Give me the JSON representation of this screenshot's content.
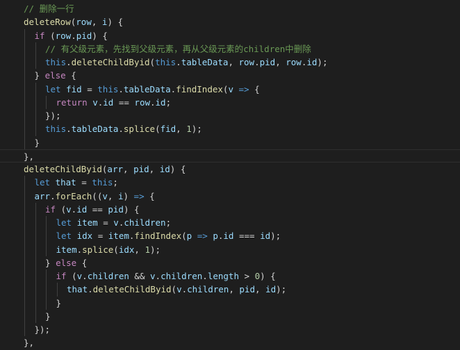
{
  "editor": {
    "theme_colors": {
      "background": "#1e1e1e",
      "comment": "#6a9955",
      "function": "#dcdcaa",
      "keyword": "#569cd6",
      "control": "#c586c0",
      "variable": "#9cdcfe",
      "number": "#b5cea8",
      "punctuation": "#d4d4d4"
    },
    "current_line": 11,
    "lines": [
      {
        "indent": 0,
        "tokens": [
          [
            "comment",
            "// 删除一行"
          ]
        ]
      },
      {
        "indent": 0,
        "tokens": [
          [
            "fn",
            "deleteRow"
          ],
          [
            "punc",
            "("
          ],
          [
            "var",
            "row"
          ],
          [
            "punc",
            ", "
          ],
          [
            "var",
            "i"
          ],
          [
            "punc",
            ") {"
          ]
        ]
      },
      {
        "indent": 1,
        "tokens": [
          [
            "ctrl",
            "if"
          ],
          [
            "punc",
            " ("
          ],
          [
            "var",
            "row"
          ],
          [
            "punc",
            "."
          ],
          [
            "var",
            "pid"
          ],
          [
            "punc",
            ") {"
          ]
        ]
      },
      {
        "indent": 2,
        "tokens": [
          [
            "comment",
            "// 有父级元素，先找到父级元素，再从父级元素的children中删除"
          ]
        ]
      },
      {
        "indent": 2,
        "tokens": [
          [
            "kw",
            "this"
          ],
          [
            "punc",
            "."
          ],
          [
            "fn",
            "deleteChildByid"
          ],
          [
            "punc",
            "("
          ],
          [
            "kw",
            "this"
          ],
          [
            "punc",
            "."
          ],
          [
            "var",
            "tableData"
          ],
          [
            "punc",
            ", "
          ],
          [
            "var",
            "row"
          ],
          [
            "punc",
            "."
          ],
          [
            "var",
            "pid"
          ],
          [
            "punc",
            ", "
          ],
          [
            "var",
            "row"
          ],
          [
            "punc",
            "."
          ],
          [
            "var",
            "id"
          ],
          [
            "punc",
            ");"
          ]
        ]
      },
      {
        "indent": 1,
        "tokens": [
          [
            "punc",
            "} "
          ],
          [
            "ctrl",
            "else"
          ],
          [
            "punc",
            " {"
          ]
        ]
      },
      {
        "indent": 2,
        "tokens": [
          [
            "kw",
            "let"
          ],
          [
            "punc",
            " "
          ],
          [
            "var",
            "fid"
          ],
          [
            "op",
            " = "
          ],
          [
            "kw",
            "this"
          ],
          [
            "punc",
            "."
          ],
          [
            "var",
            "tableData"
          ],
          [
            "punc",
            "."
          ],
          [
            "fn",
            "findIndex"
          ],
          [
            "punc",
            "("
          ],
          [
            "var",
            "v"
          ],
          [
            "kw",
            " => "
          ],
          [
            "punc",
            "{"
          ]
        ]
      },
      {
        "indent": 3,
        "tokens": [
          [
            "ctrl",
            "return"
          ],
          [
            "punc",
            " "
          ],
          [
            "var",
            "v"
          ],
          [
            "punc",
            "."
          ],
          [
            "var",
            "id"
          ],
          [
            "op",
            " == "
          ],
          [
            "var",
            "row"
          ],
          [
            "punc",
            "."
          ],
          [
            "var",
            "id"
          ],
          [
            "punc",
            ";"
          ]
        ]
      },
      {
        "indent": 2,
        "tokens": [
          [
            "punc",
            "});"
          ]
        ]
      },
      {
        "indent": 2,
        "tokens": [
          [
            "kw",
            "this"
          ],
          [
            "punc",
            "."
          ],
          [
            "var",
            "tableData"
          ],
          [
            "punc",
            "."
          ],
          [
            "fn",
            "splice"
          ],
          [
            "punc",
            "("
          ],
          [
            "var",
            "fid"
          ],
          [
            "punc",
            ", "
          ],
          [
            "num",
            "1"
          ],
          [
            "punc",
            ");"
          ]
        ]
      },
      {
        "indent": 1,
        "tokens": [
          [
            "punc",
            "}"
          ]
        ]
      },
      {
        "indent": 0,
        "tokens": [
          [
            "punc",
            "},"
          ]
        ]
      },
      {
        "indent": 0,
        "tokens": [
          [
            "fn",
            "deleteChildByid"
          ],
          [
            "punc",
            "("
          ],
          [
            "var",
            "arr"
          ],
          [
            "punc",
            ", "
          ],
          [
            "var",
            "pid"
          ],
          [
            "punc",
            ", "
          ],
          [
            "var",
            "id"
          ],
          [
            "punc",
            ") {"
          ]
        ]
      },
      {
        "indent": 1,
        "tokens": [
          [
            "kw",
            "let"
          ],
          [
            "punc",
            " "
          ],
          [
            "var",
            "that"
          ],
          [
            "op",
            " = "
          ],
          [
            "kw",
            "this"
          ],
          [
            "punc",
            ";"
          ]
        ]
      },
      {
        "indent": 1,
        "tokens": [
          [
            "var",
            "arr"
          ],
          [
            "punc",
            "."
          ],
          [
            "fn",
            "forEach"
          ],
          [
            "punc",
            "(("
          ],
          [
            "var",
            "v"
          ],
          [
            "punc",
            ", "
          ],
          [
            "var",
            "i"
          ],
          [
            "punc",
            ")"
          ],
          [
            "kw",
            " => "
          ],
          [
            "punc",
            "{"
          ]
        ]
      },
      {
        "indent": 2,
        "tokens": [
          [
            "ctrl",
            "if"
          ],
          [
            "punc",
            " ("
          ],
          [
            "var",
            "v"
          ],
          [
            "punc",
            "."
          ],
          [
            "var",
            "id"
          ],
          [
            "op",
            " == "
          ],
          [
            "var",
            "pid"
          ],
          [
            "punc",
            ") {"
          ]
        ]
      },
      {
        "indent": 3,
        "tokens": [
          [
            "kw",
            "let"
          ],
          [
            "punc",
            " "
          ],
          [
            "var",
            "item"
          ],
          [
            "op",
            " = "
          ],
          [
            "var",
            "v"
          ],
          [
            "punc",
            "."
          ],
          [
            "var",
            "children"
          ],
          [
            "punc",
            ";"
          ]
        ]
      },
      {
        "indent": 3,
        "tokens": [
          [
            "kw",
            "let"
          ],
          [
            "punc",
            " "
          ],
          [
            "var",
            "idx"
          ],
          [
            "op",
            " = "
          ],
          [
            "var",
            "item"
          ],
          [
            "punc",
            "."
          ],
          [
            "fn",
            "findIndex"
          ],
          [
            "punc",
            "("
          ],
          [
            "var",
            "p"
          ],
          [
            "kw",
            " => "
          ],
          [
            "var",
            "p"
          ],
          [
            "punc",
            "."
          ],
          [
            "var",
            "id"
          ],
          [
            "op",
            " === "
          ],
          [
            "var",
            "id"
          ],
          [
            "punc",
            ");"
          ]
        ]
      },
      {
        "indent": 3,
        "tokens": [
          [
            "var",
            "item"
          ],
          [
            "punc",
            "."
          ],
          [
            "fn",
            "splice"
          ],
          [
            "punc",
            "("
          ],
          [
            "var",
            "idx"
          ],
          [
            "punc",
            ", "
          ],
          [
            "num",
            "1"
          ],
          [
            "punc",
            ");"
          ]
        ]
      },
      {
        "indent": 2,
        "tokens": [
          [
            "punc",
            "} "
          ],
          [
            "ctrl",
            "else"
          ],
          [
            "punc",
            " {"
          ]
        ]
      },
      {
        "indent": 3,
        "tokens": [
          [
            "ctrl",
            "if"
          ],
          [
            "punc",
            " ("
          ],
          [
            "var",
            "v"
          ],
          [
            "punc",
            "."
          ],
          [
            "var",
            "children"
          ],
          [
            "op",
            " && "
          ],
          [
            "var",
            "v"
          ],
          [
            "punc",
            "."
          ],
          [
            "var",
            "children"
          ],
          [
            "punc",
            "."
          ],
          [
            "var",
            "length"
          ],
          [
            "op",
            " > "
          ],
          [
            "num",
            "0"
          ],
          [
            "punc",
            ") {"
          ]
        ]
      },
      {
        "indent": 4,
        "tokens": [
          [
            "var",
            "that"
          ],
          [
            "punc",
            "."
          ],
          [
            "fn",
            "deleteChildByid"
          ],
          [
            "punc",
            "("
          ],
          [
            "var",
            "v"
          ],
          [
            "punc",
            "."
          ],
          [
            "var",
            "children"
          ],
          [
            "punc",
            ", "
          ],
          [
            "var",
            "pid"
          ],
          [
            "punc",
            ", "
          ],
          [
            "var",
            "id"
          ],
          [
            "punc",
            ");"
          ]
        ]
      },
      {
        "indent": 3,
        "tokens": [
          [
            "punc",
            "}"
          ]
        ]
      },
      {
        "indent": 2,
        "tokens": [
          [
            "punc",
            "}"
          ]
        ]
      },
      {
        "indent": 1,
        "tokens": [
          [
            "punc",
            "});"
          ]
        ]
      },
      {
        "indent": 0,
        "tokens": [
          [
            "punc",
            "},"
          ]
        ]
      }
    ]
  }
}
